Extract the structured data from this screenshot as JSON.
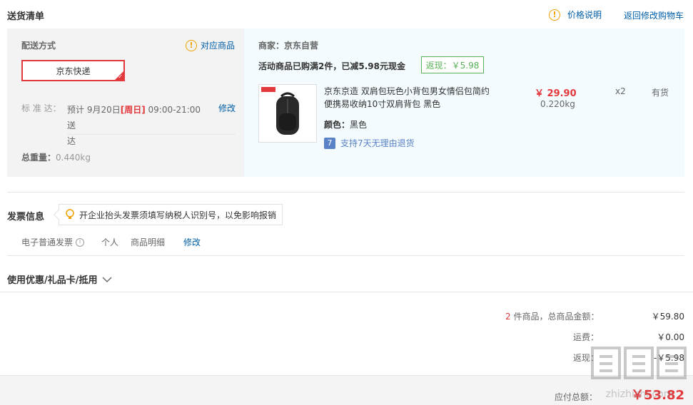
{
  "header": {
    "title": "送货清单",
    "price_note": "价格说明",
    "back_to_cart": "返回修改购物车"
  },
  "shipping": {
    "label": "配送方式",
    "related_goods": "对应商品",
    "method": "京东快递",
    "standard_label": "标 准 达：",
    "estimate_line1": "预计 9月20日",
    "estimate_day": "[周日]",
    "estimate_time": " 09:00-21:00 送",
    "estimate_line2": "达",
    "modify": "修改",
    "weight_label": "总重量：",
    "weight_value": "0.440kg"
  },
  "goods": {
    "merchant": "商家：京东自营",
    "promotion": "活动商品已购满2件，已减5.98元现金",
    "rebate": "返现：￥5.98",
    "item": {
      "name_line1": "京东京造 双肩包玩色小背包男女情侣包简约",
      "name_line2": "便携易收纳10寸双肩背包 黑色",
      "color_label": "颜色：",
      "color_value": "黑色",
      "price": "￥ 29.90",
      "weight": "0.220kg",
      "quantity": "x2",
      "stock": "有货",
      "return_badge": "7",
      "return_policy": "支持7天无理由退货"
    }
  },
  "invoice": {
    "title": "发票信息",
    "tip": "开企业抬头发票须填写纳税人识别号，以免影响报销",
    "type": "电子普通发票",
    "info_glyph": "i",
    "target": "个人",
    "content": "商品明细",
    "modify": "修改"
  },
  "coupon": {
    "title": "使用优惠/礼品卡/抵用"
  },
  "summary": {
    "count": "2",
    "count_label": " 件商品，总商品金额：",
    "total": "￥59.80",
    "freight_label": "运费：",
    "freight": "￥0.00",
    "rebate_label": "返现：",
    "rebate": "-￥5.98",
    "payable_label": "应付总额：",
    "payable": "￥53.82"
  },
  "watermark": {
    "text": "zhizhizhi.com"
  }
}
